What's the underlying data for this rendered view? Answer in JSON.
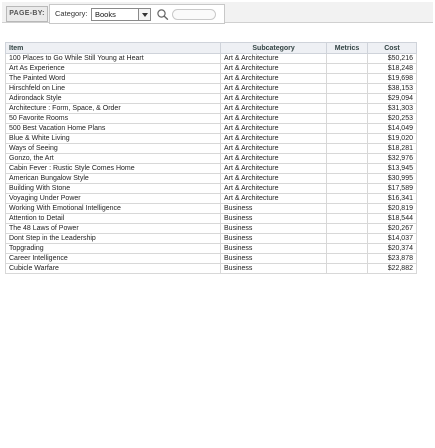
{
  "page_by": {
    "label": "PAGE-BY:",
    "category_label": "Category:",
    "category_value": "Books"
  },
  "grid": {
    "headers": {
      "item": "Item",
      "subcategory": "Subcategory",
      "metrics": "Metrics",
      "cost": "Cost"
    },
    "rows": [
      {
        "item": "100 Places to Go While Still Young at Heart",
        "subcategory": "Art & Architecture",
        "cost": "$50,216"
      },
      {
        "item": "Art As Experience",
        "subcategory": "Art & Architecture",
        "cost": "$18,248"
      },
      {
        "item": "The Painted Word",
        "subcategory": "Art & Architecture",
        "cost": "$19,698"
      },
      {
        "item": "Hirschfeld on Line",
        "subcategory": "Art & Architecture",
        "cost": "$38,153"
      },
      {
        "item": "Adirondack Style",
        "subcategory": "Art & Architecture",
        "cost": "$29,094"
      },
      {
        "item": "Architecture : Form, Space, & Order",
        "subcategory": "Art & Architecture",
        "cost": "$31,303"
      },
      {
        "item": "50 Favorite Rooms",
        "subcategory": "Art & Architecture",
        "cost": "$20,253"
      },
      {
        "item": "500 Best Vacation Home Plans",
        "subcategory": "Art & Architecture",
        "cost": "$14,049"
      },
      {
        "item": "Blue & White Living",
        "subcategory": "Art & Architecture",
        "cost": "$19,020"
      },
      {
        "item": "Ways of Seeing",
        "subcategory": "Art & Architecture",
        "cost": "$18,281"
      },
      {
        "item": "Gonzo, the Art",
        "subcategory": "Art & Architecture",
        "cost": "$32,976"
      },
      {
        "item": "Cabin Fever : Rustic Style Comes Home",
        "subcategory": "Art & Architecture",
        "cost": "$13,945"
      },
      {
        "item": "American Bungalow Style",
        "subcategory": "Art & Architecture",
        "cost": "$30,995"
      },
      {
        "item": "Building With Stone",
        "subcategory": "Art & Architecture",
        "cost": "$17,589"
      },
      {
        "item": "Voyaging Under Power",
        "subcategory": "Art & Architecture",
        "cost": "$16,341"
      },
      {
        "item": "Working With Emotional Intelligence",
        "subcategory": "Business",
        "cost": "$20,819"
      },
      {
        "item": "Attention to Detail",
        "subcategory": "Business",
        "cost": "$18,544"
      },
      {
        "item": "The 48 Laws of Power",
        "subcategory": "Business",
        "cost": "$20,267"
      },
      {
        "item": "Dont Step in the Leadership",
        "subcategory": "Business",
        "cost": "$14,037"
      },
      {
        "item": "Topgrading",
        "subcategory": "Business",
        "cost": "$20,374"
      },
      {
        "item": "Career Intelligence",
        "subcategory": "Business",
        "cost": "$23,878"
      },
      {
        "item": "Cubicle Warfare",
        "subcategory": "Business",
        "cost": "$22,882"
      }
    ]
  }
}
